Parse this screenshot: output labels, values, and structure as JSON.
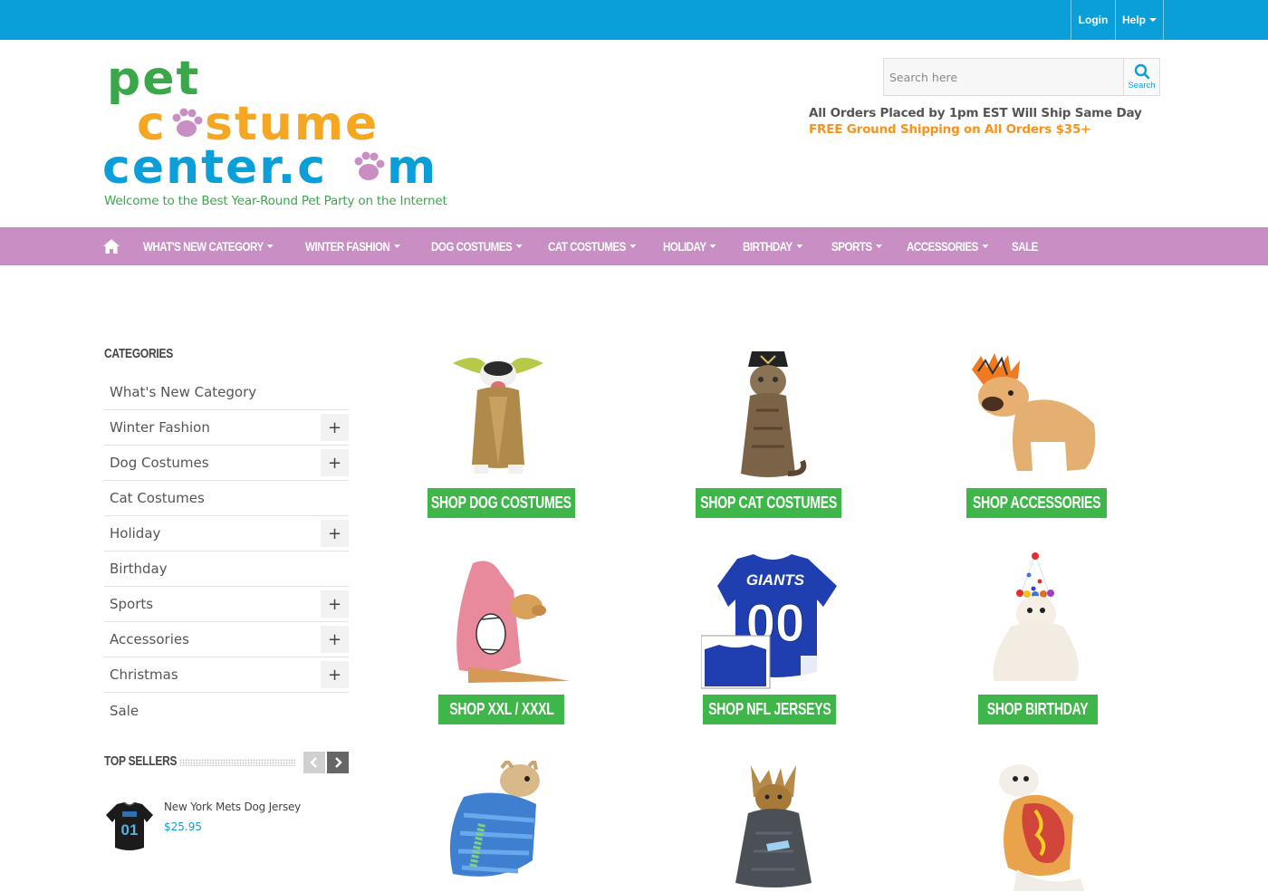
{
  "topbar": {
    "login": "Login",
    "help": "Help"
  },
  "logo": {
    "line1": "pet",
    "line2": "c",
    "line2b": "stume",
    "line3": "center.c",
    "line3b": "m",
    "tagline": "Welcome to the Best Year-Round Pet Party on the Internet"
  },
  "search": {
    "placeholder": "Search here",
    "button": "Search"
  },
  "shipping": {
    "line1": "All Orders Placed by 1pm EST Will Ship Same Day",
    "line2": "FREE Ground Shipping on All Orders $35+"
  },
  "nav": {
    "items": [
      "WHAT'S NEW CATEGORY",
      "WINTER FASHION",
      "DOG COSTUMES",
      "CAT COSTUMES",
      "HOLIDAY",
      "BIRTHDAY",
      "SPORTS",
      "ACCESSORIES",
      "SALE"
    ]
  },
  "sidebar": {
    "title": "CATEGORIES",
    "items": [
      "What's New Category",
      "Winter Fashion",
      "Dog Costumes",
      "Cat Costumes",
      "Holiday",
      "Birthday",
      "Sports",
      "Accessories",
      "Christmas",
      "Sale"
    ],
    "top_sellers": {
      "title": "TOP SELLERS",
      "product": {
        "name": "New York Mets Dog Jersey",
        "price": "$25.95"
      }
    }
  },
  "grid": {
    "buttons": [
      "SHOP DOG COSTUMES",
      "SHOP CAT COSTUMES",
      "SHOP ACCESSORIES",
      "SHOP XXL / XXXL",
      "SHOP NFL JERSEYS",
      "SHOP BIRTHDAY"
    ],
    "jersey_text": "GIANTS",
    "jersey_number": "00"
  },
  "colors": {
    "topbar": "#0a9fd8",
    "nav": "#c98ec4",
    "button": "#3fb64a",
    "accent_orange": "#f7931e",
    "green": "#3aa84a"
  }
}
